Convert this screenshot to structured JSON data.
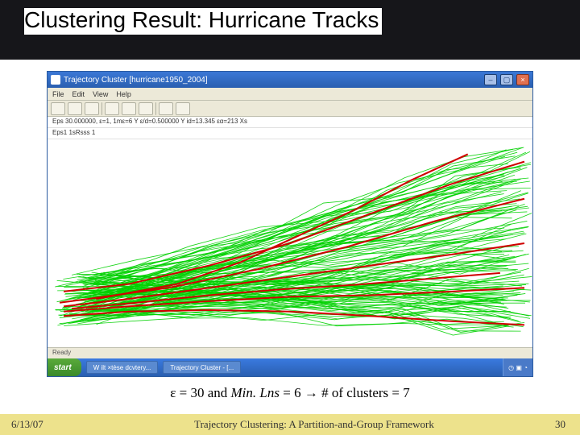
{
  "title": "Clustering Result: Hurricane Tracks",
  "caption": {
    "eps_label": "ε = ",
    "eps_value": "30",
    "and": " and ",
    "minlns_label": "Min. Lns",
    "minlns_eq": " = ",
    "minlns_value": "6",
    "arrow": " → ",
    "clusters_label": "# of clusters = ",
    "clusters_value": "7"
  },
  "footer": {
    "date": "6/13/07",
    "title": "Trajectory Clustering: A Partition-and-Group Framework",
    "page": "30"
  },
  "app": {
    "window_title": "Trajectory Cluster  [hurricane1950_2004]",
    "menu": [
      "File",
      "Edit",
      "View",
      "Help"
    ],
    "param1": "Eps 30.000000, ε=1, 1mε=6  Y  ε/d=0.500000 Y  id=13.345 εα=213 Xs",
    "param2": "Eps1 1sRsss  1",
    "status": "Ready",
    "start": "start",
    "task1": "Trajectory Cluster - [...",
    "task2": "W   ilt  ×tèse  dcvtery..."
  },
  "colors": {
    "track": "#00d000",
    "rep": "#d00000"
  }
}
